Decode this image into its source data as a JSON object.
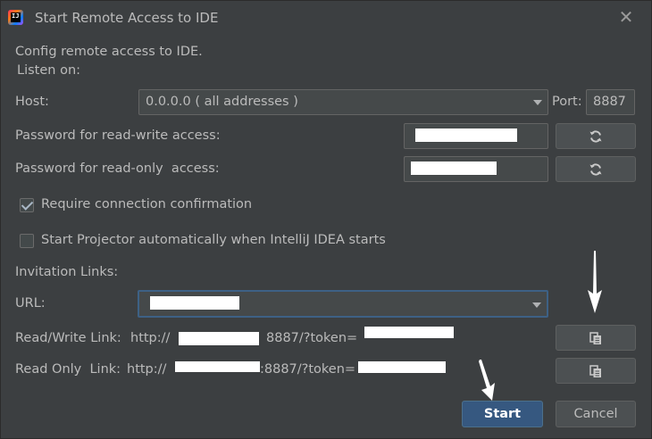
{
  "window": {
    "title": "Start Remote Access to IDE",
    "app_icon_text": "IJ"
  },
  "intro": {
    "line1": "Config remote access to IDE.",
    "line2": "Listen on:"
  },
  "host": {
    "label": "Host:",
    "value": "0.0.0.0 ( all addresses )"
  },
  "port": {
    "label": "Port:",
    "value": "8887"
  },
  "passwords": {
    "rw_label": "Password for read-write access:",
    "ro_label": "Password for read-only  access:"
  },
  "options": {
    "require_confirmation": {
      "label": "Require connection confirmation",
      "checked": true
    },
    "auto_start": {
      "label": "Start Projector automatically when IntelliJ IDEA starts",
      "checked": false
    }
  },
  "invitation": {
    "heading": "Invitation Links:",
    "url_label": "URL:",
    "rw_link_label": "Read/Write Link:",
    "rw_link_prefix": "http://",
    "rw_link_mid": "8887/?token=",
    "ro_link_label": "Read Only  Link:",
    "ro_link_prefix": "http://",
    "ro_link_mid": ":8887/?token="
  },
  "buttons": {
    "start": "Start",
    "cancel": "Cancel"
  },
  "icons": {
    "refresh": "refresh-icon",
    "copy": "copy-icon",
    "close": "close-icon",
    "dropdown": "chevron-down-icon"
  },
  "colors": {
    "background": "#3c3f41",
    "primary_button": "#365880",
    "field_bg": "#45494a",
    "focus_border": "#3d6185"
  }
}
